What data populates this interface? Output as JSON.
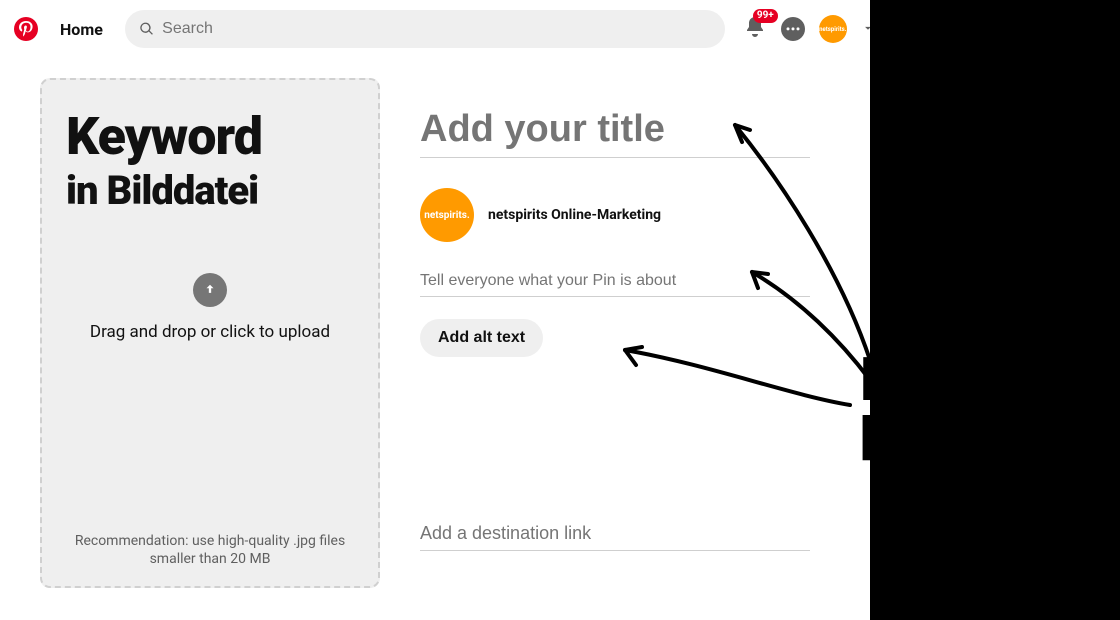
{
  "nav": {
    "home_label": "Home",
    "search_placeholder": "Search",
    "badge_count": "99+",
    "avatar_text": "netspirits."
  },
  "upload": {
    "kw_line1": "Keyword",
    "kw_line2": "in Bilddatei",
    "instructions": "Drag and drop or click to upload",
    "recommendation": "Recommendation: use high-quality .jpg files smaller than 20 MB"
  },
  "form": {
    "title_placeholder": "Add your title",
    "author_name": "netspirits Online-Marketing",
    "author_avatar_text": "netspirits.",
    "description_placeholder": "Tell everyone what your Pin is about",
    "alt_button": "Add alt text",
    "destination_placeholder": "Add a destination link"
  },
  "overlay": {
    "line1": "Key",
    "line2": "hinz"
  }
}
